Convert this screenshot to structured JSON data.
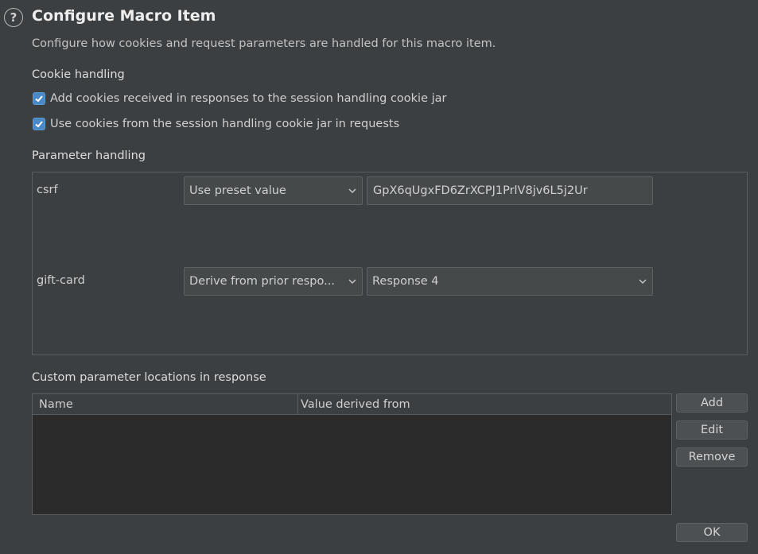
{
  "dialog": {
    "title": "Configure Macro Item",
    "description": "Configure how cookies and request parameters are handled for this macro item."
  },
  "cookie_handling": {
    "label": "Cookie handling",
    "options": [
      {
        "label": "Add cookies received in responses to the session handling cookie jar",
        "checked": true
      },
      {
        "label": "Use cookies from the session handling cookie jar in requests",
        "checked": true
      }
    ]
  },
  "parameter_handling": {
    "label": "Parameter handling",
    "params": [
      {
        "name": "csrf",
        "mode": "Use preset value",
        "value": "GpX6qUgxFD6ZrXCPJ1PrlV8jv6L5j2Ur"
      },
      {
        "name": "gift-card",
        "mode": "Derive from prior respo...",
        "value": "Response 4"
      }
    ]
  },
  "custom_locations": {
    "label": "Custom parameter locations in response",
    "columns": [
      "Name",
      "Value derived from"
    ],
    "rows": [],
    "buttons": {
      "add": "Add",
      "edit": "Edit",
      "remove": "Remove"
    }
  },
  "footer": {
    "ok": "OK"
  },
  "icons": {
    "help": "help-icon",
    "dropdown": "chevron-down-icon",
    "check": "check-icon"
  },
  "colors": {
    "background": "#3c3f41",
    "checkbox": "#4a88c7",
    "table_background": "#2b2b2b"
  }
}
